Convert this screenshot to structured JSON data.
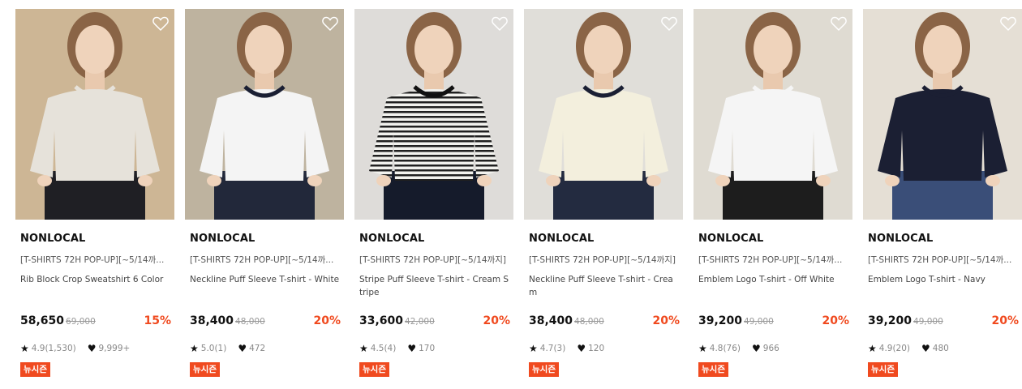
{
  "products": [
    {
      "brand": "NONLOCAL",
      "promo": "[T-SHIRTS 72H POP-UP][~5/14까...",
      "name": "Rib Block Crop Sweatshirt 6 Color",
      "price": "58,650",
      "original_price": "69,000",
      "discount": "15%",
      "rating": "4.9(1,530)",
      "likes": "9,999+",
      "badge": "뉴시즌",
      "bg": "#c9b08c",
      "top": "#e6e2da",
      "bottom": "#1f1f24",
      "trim": "#e6e2da"
    },
    {
      "brand": "NONLOCAL",
      "promo": "[T-SHIRTS 72H POP-UP][~5/14까...",
      "name": "Neckline Puff Sleeve T-shirt - White",
      "price": "38,400",
      "original_price": "48,000",
      "discount": "20%",
      "rating": "5.0(1)",
      "likes": "472",
      "badge": "뉴시즌",
      "bg": "#b9ad97",
      "top": "#f4f4f4",
      "bottom": "#22283a",
      "trim": "#1a1f33"
    },
    {
      "brand": "NONLOCAL",
      "promo": "[T-SHIRTS 72H POP-UP][~5/14까지]",
      "name": "Stripe Puff Sleeve T-shirt - Cream Stripe",
      "price": "33,600",
      "original_price": "42,000",
      "discount": "20%",
      "rating": "4.5(4)",
      "likes": "170",
      "badge": "뉴시즌",
      "bg": "#dcdad6",
      "top": "stripe",
      "bottom": "#151b2b",
      "trim": "#111111"
    },
    {
      "brand": "NONLOCAL",
      "promo": "[T-SHIRTS 72H POP-UP][~5/14까지]",
      "name": "Neckline Puff Sleeve T-shirt - Cream",
      "price": "38,400",
      "original_price": "48,000",
      "discount": "20%",
      "rating": "4.7(3)",
      "likes": "120",
      "badge": "뉴시즌",
      "bg": "#dedcd6",
      "top": "#f3efdd",
      "bottom": "#232b40",
      "trim": "#1a1f33"
    },
    {
      "brand": "NONLOCAL",
      "promo": "[T-SHIRTS 72H POP-UP][~5/14까...",
      "name": "Emblem Logo T-shirt - Off White",
      "price": "39,200",
      "original_price": "49,000",
      "discount": "20%",
      "rating": "4.8(76)",
      "likes": "966",
      "badge": "뉴시즌",
      "bg": "#ddd8cf",
      "top": "#f5f5f5",
      "bottom": "#1d1d1d",
      "trim": "#f5f5f5"
    },
    {
      "brand": "NONLOCAL",
      "promo": "[T-SHIRTS 72H POP-UP][~5/14까...",
      "name": "Emblem Logo T-shirt - Navy",
      "price": "39,200",
      "original_price": "49,000",
      "discount": "20%",
      "rating": "4.9(20)",
      "likes": "480",
      "badge": "뉴시즌",
      "bg": "#e3ddd2",
      "top": "#1b1f33",
      "bottom": "#3a4e78",
      "trim": "#1b1f33"
    }
  ]
}
